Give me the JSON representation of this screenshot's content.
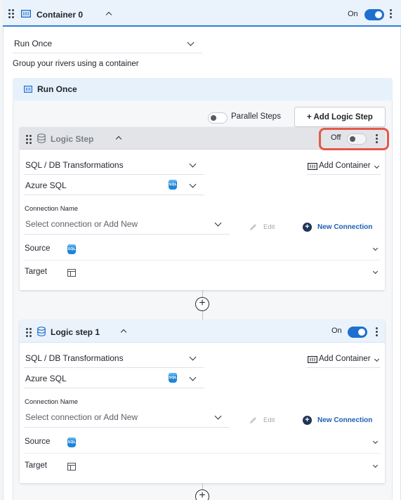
{
  "container": {
    "title": "Container 0",
    "state_label": "On",
    "run_mode": "Run Once",
    "description": "Group your rivers using a container"
  },
  "run_once_section": {
    "title": "Run Once",
    "parallel_steps_label": "Parallel Steps",
    "add_logic_step_label": "+ Add Logic Step"
  },
  "steps": [
    {
      "title": "Logic Step",
      "state_label": "Off",
      "enabled": false,
      "transformation_type": "SQL / DB Transformations",
      "database": "Azure SQL",
      "add_container_label": "Add Container",
      "connection_name_label": "Connection Name",
      "connection_placeholder": "Select connection or Add New",
      "edit_label": "Edit",
      "new_connection_label": "New Connection",
      "source_label": "Source",
      "target_label": "Target"
    },
    {
      "title": "Logic step 1",
      "state_label": "On",
      "enabled": true,
      "transformation_type": "SQL / DB Transformations",
      "database": "Azure SQL",
      "add_container_label": "Add Container",
      "connection_name_label": "Connection Name",
      "connection_placeholder": "Select connection or Add New",
      "edit_label": "Edit",
      "new_connection_label": "New Connection",
      "source_label": "Source",
      "target_label": "Target"
    }
  ],
  "icons": {
    "drag": "drag-handle-icon",
    "container": "container-icon",
    "database": "database-icon",
    "sql": "azure-sql-icon",
    "table": "table-icon",
    "add": "plus-circle-icon",
    "edit": "pencil-icon",
    "menu": "kebab-menu-icon"
  },
  "colors": {
    "accent": "#1e6fd0",
    "highlight": "#e5584a",
    "header_blue": "#eaf3fb",
    "header_gray": "#e2e4e8"
  }
}
